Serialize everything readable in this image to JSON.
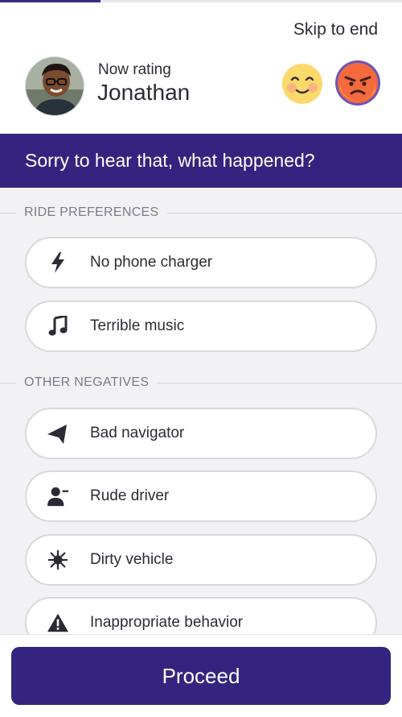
{
  "progress": {
    "fraction": 0.25,
    "color": "#3a2a86"
  },
  "header": {
    "skip_label": "Skip to end",
    "rating_caption": "Now rating",
    "driver_name": "Jonathan",
    "emoji_options": [
      {
        "name": "happy",
        "icon": "smiling-face-icon"
      },
      {
        "name": "angry",
        "icon": "angry-face-icon",
        "selected": true
      }
    ]
  },
  "prompt": {
    "text": "Sorry to hear that, what happened?"
  },
  "sections": [
    {
      "title": "RIDE PREFERENCES",
      "items": [
        {
          "label": "No phone charger",
          "icon": "lightning-bolt-icon"
        },
        {
          "label": "Terrible music",
          "icon": "music-note-icon"
        }
      ]
    },
    {
      "title": "OTHER NEGATIVES",
      "items": [
        {
          "label": "Bad navigator",
          "icon": "navigation-arrow-icon"
        },
        {
          "label": "Rude driver",
          "icon": "person-minus-icon"
        },
        {
          "label": "Dirty vehicle",
          "icon": "splat-icon"
        },
        {
          "label": "Inappropriate behavior",
          "icon": "warning-triangle-icon"
        }
      ]
    }
  ],
  "footer": {
    "proceed_label": "Proceed"
  },
  "colors": {
    "accent": "#34247f",
    "background": "#f2f2f5"
  }
}
